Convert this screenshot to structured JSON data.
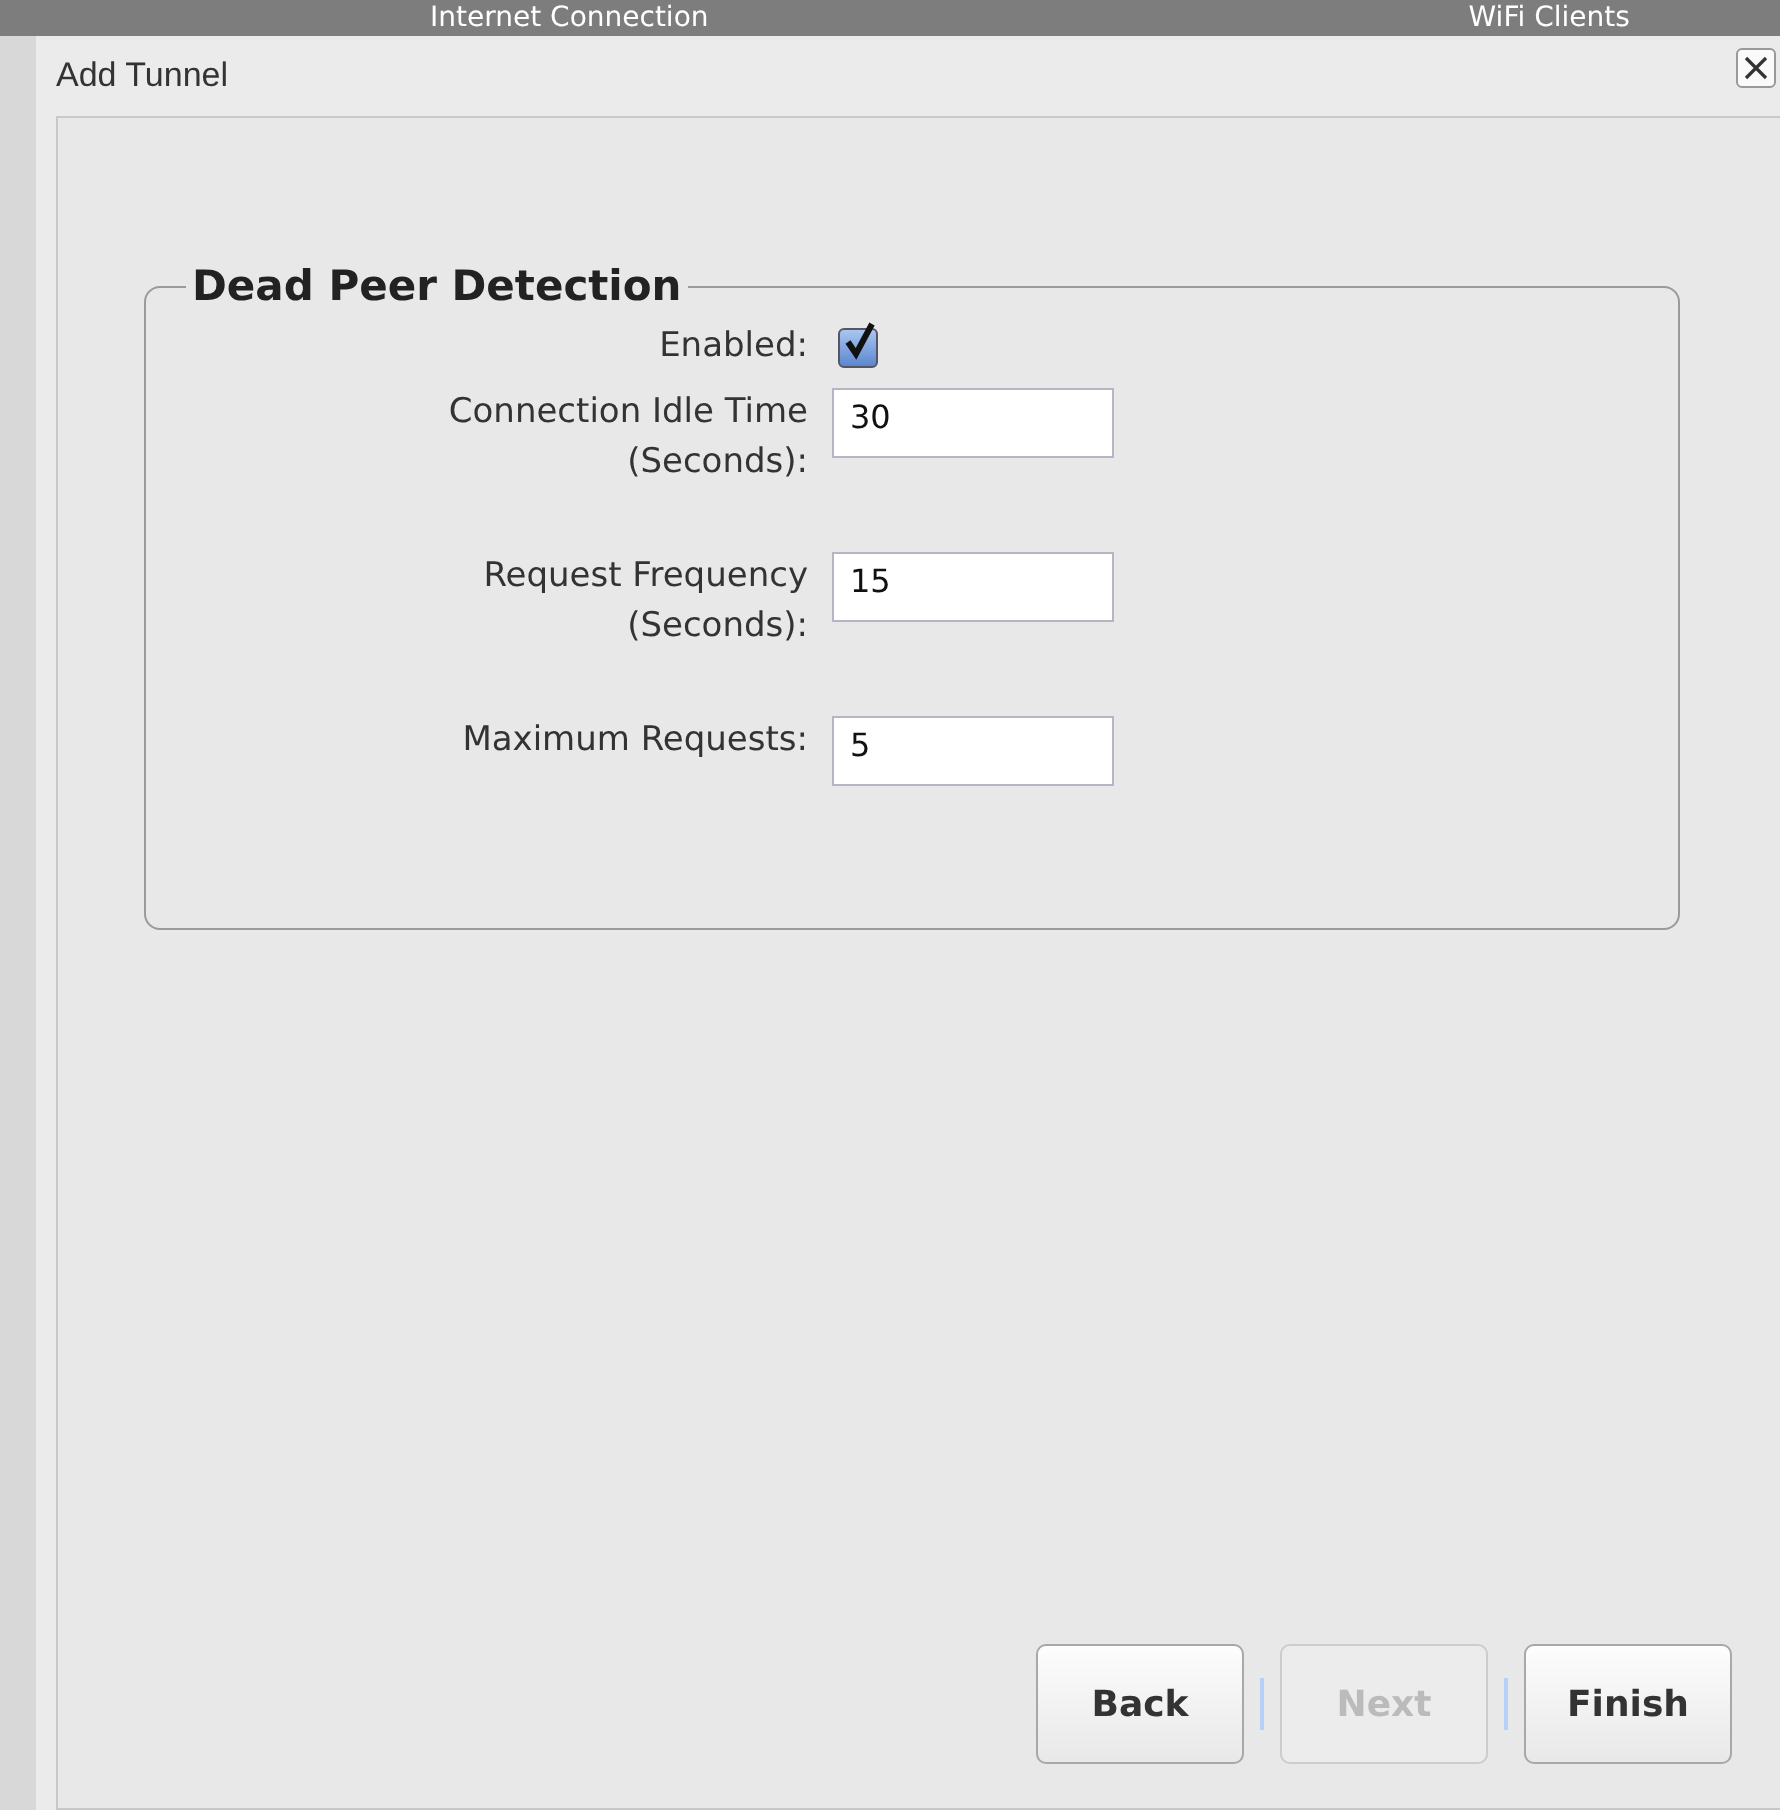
{
  "background": {
    "texts": [
      "Internet Connection",
      "WiFi Clients"
    ]
  },
  "window": {
    "title": "Add Tunnel"
  },
  "fieldset": {
    "legend": "Dead Peer Detection",
    "fields": [
      {
        "kind": "checkbox",
        "label": "Enabled:",
        "checked": true
      },
      {
        "kind": "text",
        "label": "Connection Idle Time (Seconds):",
        "value": "30"
      },
      {
        "kind": "text",
        "label": "Request Frequency (Seconds):",
        "value": "15"
      },
      {
        "kind": "text",
        "label": "Maximum Requests:",
        "value": "5"
      }
    ]
  },
  "buttons": [
    {
      "label": "Back",
      "disabled": false
    },
    {
      "label": "Next",
      "disabled": true
    },
    {
      "label": "Finish",
      "disabled": false
    }
  ]
}
